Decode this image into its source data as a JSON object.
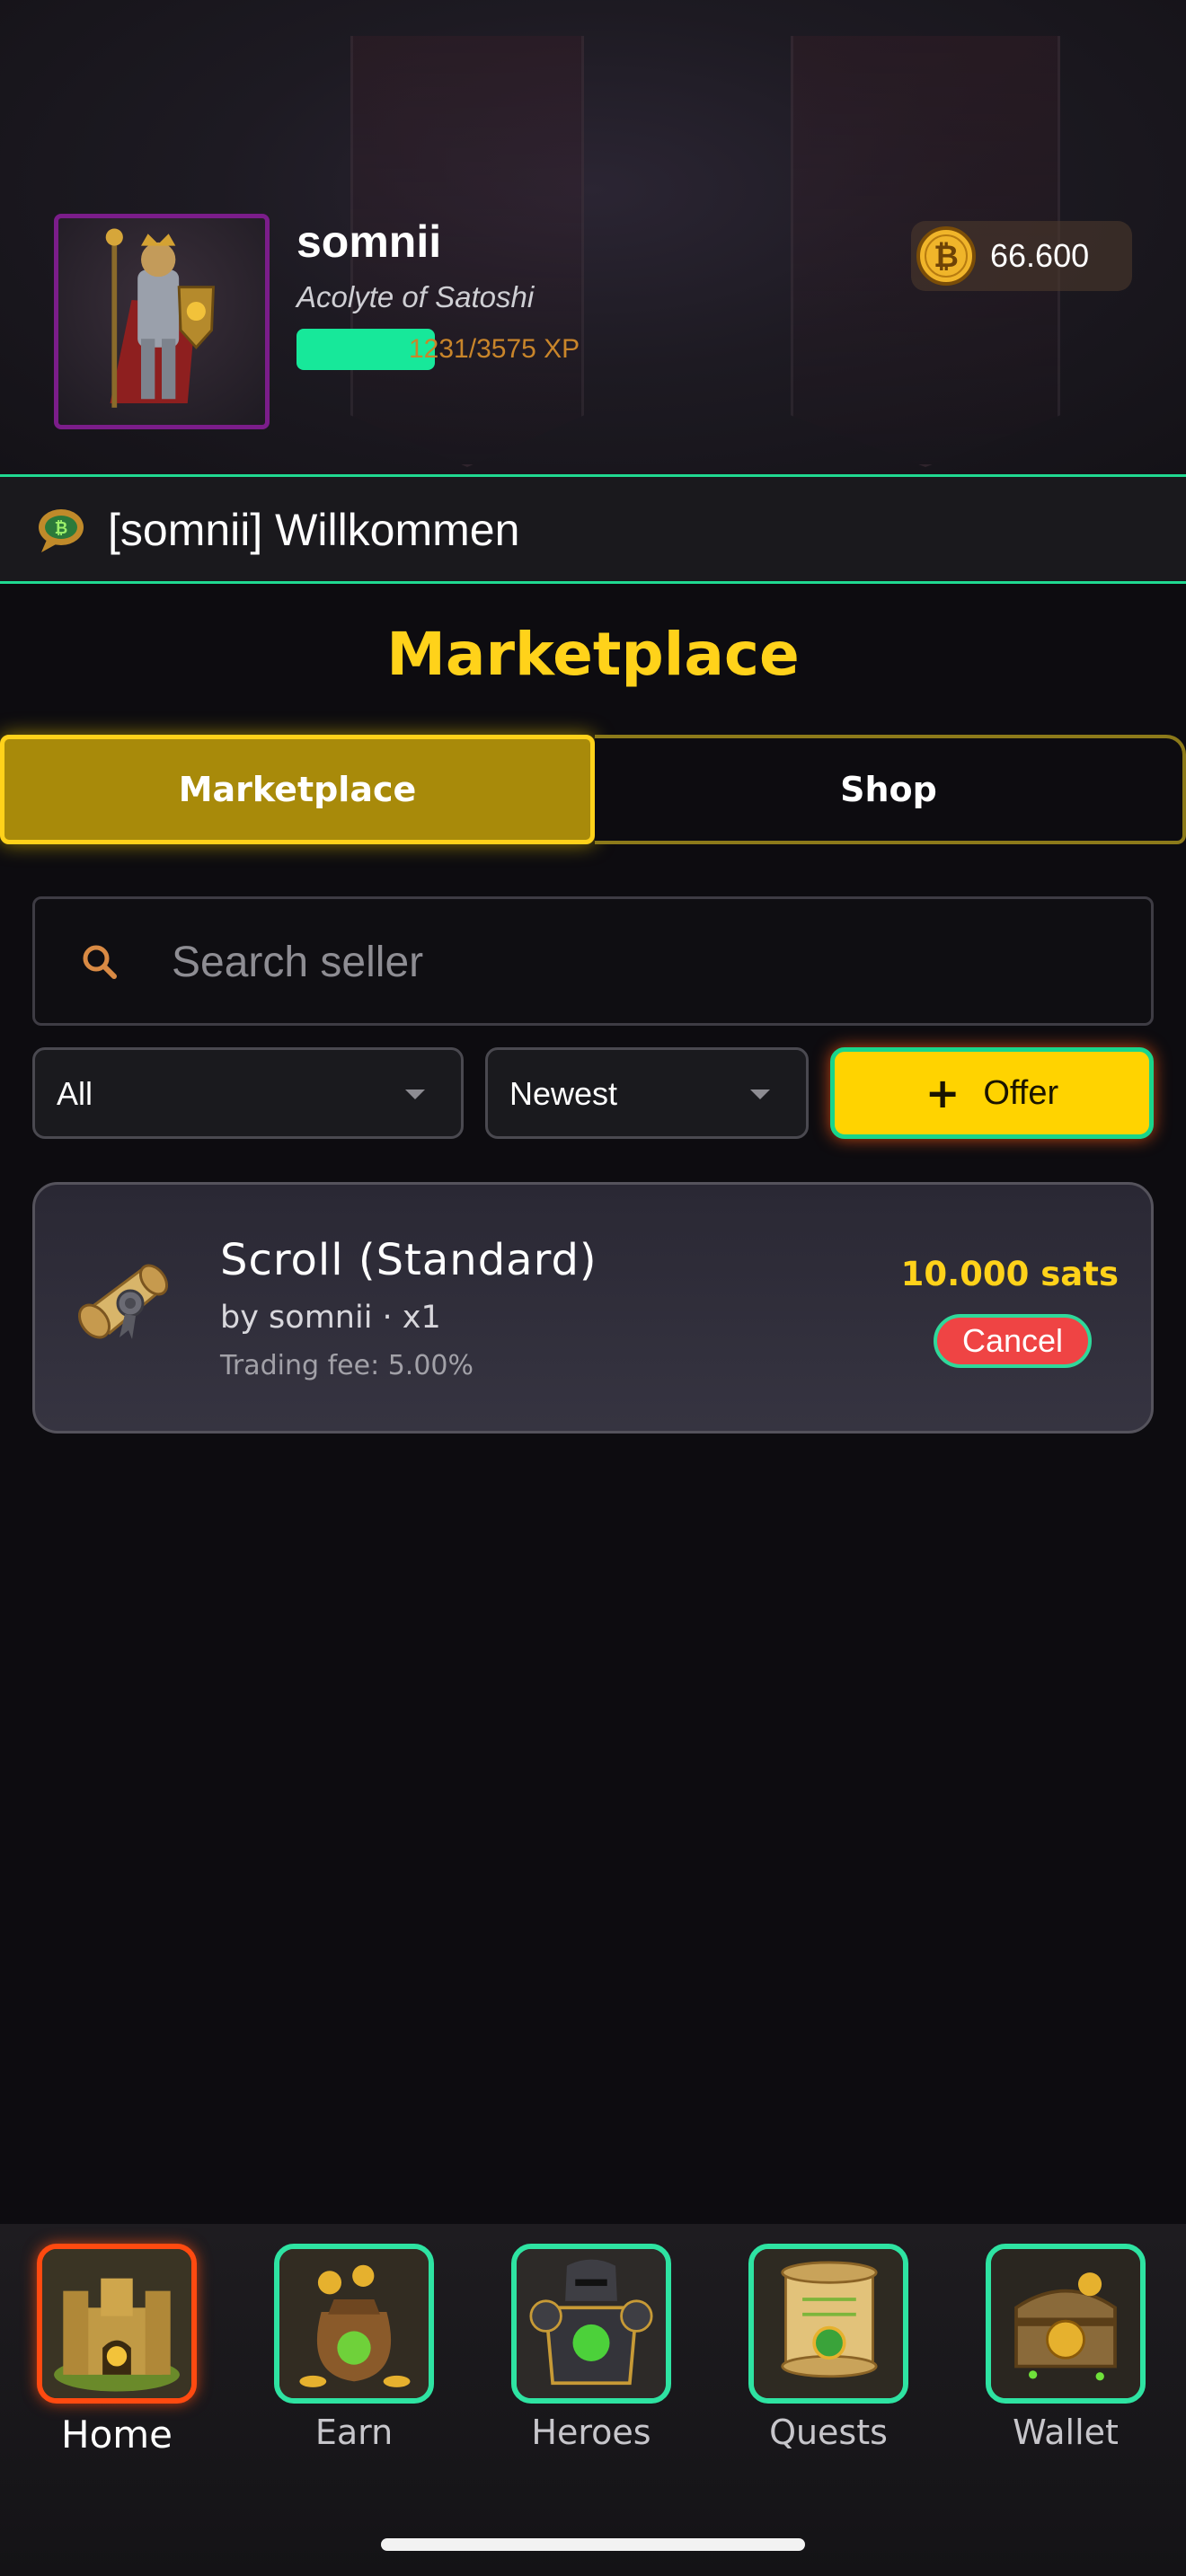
{
  "profile": {
    "username": "somnii",
    "rank": "Acolyte of Satoshi",
    "xp_text": "1231/3575 XP",
    "xp_current": 1231,
    "xp_max": 3575,
    "coins": "66.600"
  },
  "ticker": {
    "message": "[somnii] Willkommen"
  },
  "page": {
    "title": "Marketplace"
  },
  "tabs": [
    {
      "label": "Marketplace",
      "active": true
    },
    {
      "label": "Shop",
      "active": false
    }
  ],
  "search": {
    "placeholder": "Search seller",
    "value": ""
  },
  "filters": {
    "category": "All",
    "sort": "Newest",
    "offer_label": "Offer"
  },
  "listings": [
    {
      "name": "Scroll (Standard)",
      "seller_line": "by somnii · x1",
      "fee_line": "Trading fee: 5.00%",
      "price": "10.000 sats",
      "action_label": "Cancel"
    }
  ],
  "nav": [
    {
      "label": "Home",
      "icon": "castle-icon",
      "active": true
    },
    {
      "label": "Earn",
      "icon": "coin-sack-icon",
      "active": false
    },
    {
      "label": "Heroes",
      "icon": "armor-icon",
      "active": false
    },
    {
      "label": "Quests",
      "icon": "scroll-icon",
      "active": false
    },
    {
      "label": "Wallet",
      "icon": "chest-icon",
      "active": false
    }
  ],
  "colors": {
    "accent_gold": "#ffd21a",
    "accent_green": "#20d991",
    "danger": "#ef4444",
    "background": "#0d0c10"
  }
}
